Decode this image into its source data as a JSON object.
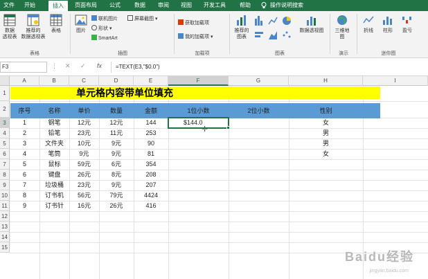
{
  "ribbon_tabs": [
    "文件",
    "开始",
    "插入",
    "页面布局",
    "公式",
    "数据",
    "审阅",
    "视图",
    "开发工具",
    "帮助",
    "操作说明搜索"
  ],
  "active_tab": "插入",
  "ribbon": {
    "tables_group": {
      "label": "表格",
      "pivot": "数据\n透视表",
      "recommended_pivot": "推荐的\n数据透视表",
      "table": "表格"
    },
    "illustrations_group": {
      "label": "插图",
      "pictures": "图片",
      "online_pictures": "联机图片",
      "shapes": "形状",
      "smartart": "SmartArt",
      "screenshot": "屏幕截图"
    },
    "addins_group": {
      "label": "加载项",
      "get_addins": "获取加载项",
      "my_addins": "我的加载项"
    },
    "charts_group": {
      "label": "图表",
      "recommended_charts": "推荐的\n图表",
      "pivot_chart": "数据透视图"
    },
    "tours_group": {
      "label": "演示",
      "map_3d": "三维地\n图"
    },
    "sparklines_group": {
      "label": "迷你图",
      "line": "折线",
      "column": "柱形",
      "win_loss": "盈亏"
    }
  },
  "formula_bar": {
    "name_box": "F3",
    "formula": "=TEXT(E3,\"$0.0\")"
  },
  "columns": [
    "A",
    "B",
    "C",
    "D",
    "E",
    "F",
    "G",
    "H",
    "I"
  ],
  "rows": [
    "1",
    "2",
    "3",
    "4",
    "5",
    "6",
    "7",
    "8",
    "9",
    "10",
    "11",
    "12",
    "13",
    "14",
    "15"
  ],
  "sheet": {
    "title": "单元格内容带单位填充",
    "headers": [
      "序号",
      "名称",
      "单价",
      "数量",
      "金额",
      "1位小数",
      "2位小数",
      "性别"
    ],
    "data": [
      [
        "1",
        "钢笔",
        "12元",
        "12元",
        "144",
        "$144.0",
        "",
        "女"
      ],
      [
        "2",
        "铅笔",
        "23元",
        "11元",
        "253",
        "",
        "",
        "男"
      ],
      [
        "3",
        "文件夹",
        "10元",
        "9元",
        "90",
        "",
        "",
        "男"
      ],
      [
        "4",
        "笔筒",
        "9元",
        "9元",
        "81",
        "",
        "",
        "女"
      ],
      [
        "5",
        "鼠标",
        "59元",
        "6元",
        "354",
        "",
        "",
        ""
      ],
      [
        "6",
        "键盘",
        "26元",
        "8元",
        "208",
        "",
        "",
        ""
      ],
      [
        "7",
        "垃圾桶",
        "23元",
        "9元",
        "207",
        "",
        "",
        ""
      ],
      [
        "8",
        "订书机",
        "56元",
        "79元",
        "4424",
        "",
        "",
        ""
      ],
      [
        "9",
        "订书针",
        "16元",
        "26元",
        "416",
        "",
        "",
        ""
      ]
    ]
  },
  "watermark": {
    "brand": "Baidu经验",
    "url": "jingyan.baidu.com"
  }
}
